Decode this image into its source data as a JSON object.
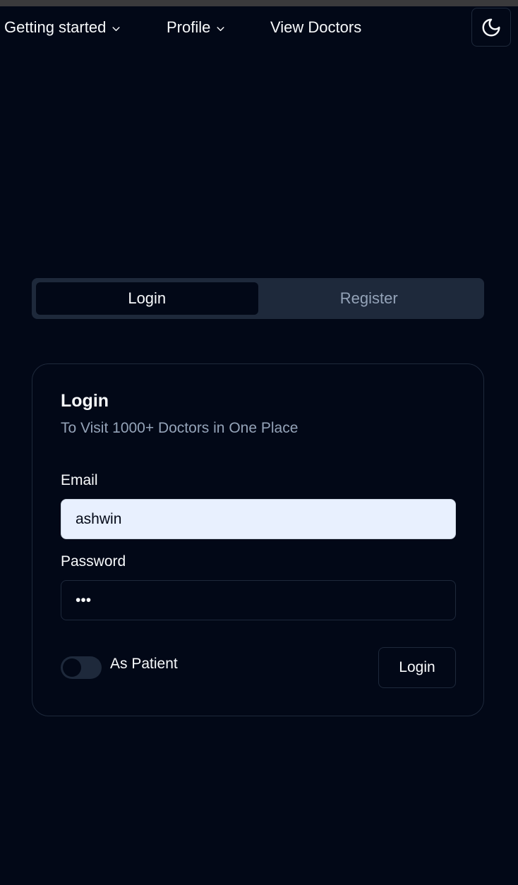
{
  "nav": {
    "getting_started": "Getting started",
    "profile": "Profile",
    "view_doctors": "View Doctors",
    "theme_icon": "moon-icon"
  },
  "tabs": {
    "login": "Login",
    "register": "Register",
    "active": "Login"
  },
  "card": {
    "title": "Login",
    "description": "To Visit 1000+ Doctors in One Place",
    "email_label": "Email",
    "email_value": "ashwin",
    "password_label": "Password",
    "password_value": "•••",
    "toggle_label": "As Patient",
    "toggle_on": false,
    "submit_label": "Login"
  },
  "colors": {
    "background": "#020817",
    "muted": "#1e293b",
    "muted_text": "#94a3b8",
    "foreground": "#f8fafc",
    "autofill": "#e8f0fe"
  }
}
